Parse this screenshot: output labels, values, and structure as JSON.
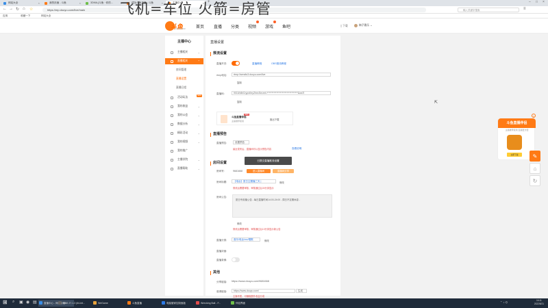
{
  "browser": {
    "tabs": [
      {
        "label": "网站大全",
        "color": "#3a8ee6"
      },
      {
        "label": "我的页面 - 斗鱼",
        "color": "#ff7a15"
      },
      {
        "label": "3DMA-[斗鱼 · 你的...",
        "color": "#6fbf4a"
      },
      {
        "label": "成功斗鱼主播 - 斗鱼",
        "color": "#ff7a15"
      },
      {
        "label": "主播中心",
        "color": "#ff7a15"
      }
    ],
    "url": "https://mp.douyu.com/live/main",
    "search_placeholder": "输入关键字搜索",
    "bookmarks": [
      "应用",
      "收藏一下",
      "网站大全"
    ]
  },
  "overlay_text": "飞机=车位 火箭=房管",
  "site": {
    "logo_text": "斗鱼",
    "logo_sub": "DOUYU.COM",
    "nav": [
      "首页",
      "直播",
      "分类",
      "视频",
      "游戏",
      "鱼吧"
    ],
    "phone_label": "下载",
    "user_label": "梅子雅乐"
  },
  "sidebar": {
    "title": "主播中心",
    "items": [
      {
        "label": "主播相关",
        "active": false
      },
      {
        "label": "直播相关",
        "active": true
      }
    ],
    "subitems": [
      {
        "label": "房间管理",
        "on": false
      },
      {
        "label": "直播设置",
        "on": true
      },
      {
        "label": "直播日程",
        "on": false
      }
    ],
    "items2": [
      {
        "label": "活动玩法",
        "new": true
      },
      {
        "label": "我的收益",
        "new": false
      },
      {
        "label": "我的公会",
        "new": false
      },
      {
        "label": "数据分析",
        "new": false
      },
      {
        "label": "精彩活动",
        "new": false
      },
      {
        "label": "我的视频",
        "new": false
      },
      {
        "label": "我的推广",
        "new": false
      },
      {
        "label": "主播学院",
        "new": false
      },
      {
        "label": "直播帮助",
        "new": false
      }
    ],
    "new_tag": "NEW"
  },
  "main": {
    "page_title": "直播设置",
    "sec_push": "推流设置",
    "push_label": "直播开关:",
    "push_link1": "直播教程",
    "push_link2": "OBS推流教程",
    "rtmp_label": "rtmp地址:",
    "rtmp_value": "rtmp://sendtc3.douyu.com/live",
    "copy": "复制",
    "key_label": "直播码:",
    "key_value": "9016/b8rCrypsKeyZhecSecret=*********************************&wsTi",
    "helper_title": "斗鱼直播伴侣",
    "helper_sub": "主播推荐使用",
    "helper_new": "NEW",
    "helper_download": "推出下载",
    "sec_preview": "直播预告",
    "preview_label": "直播预告:",
    "preview_btn": "设置预告",
    "preview_note": "最近发布后，直播间可以显示预告内容",
    "preview_link": "查看说明",
    "toast": "已提交直播推流设置",
    "sec_room": "房间设置",
    "room_num_label": "房间号:",
    "room_num": "9681668",
    "room_btn1": "进入直播间",
    "room_btn2": "直播间分享",
    "room_name_label": "房间标题:",
    "room_name": "【电台】夏日主题播三天 |",
    "room_name_btn": "修改",
    "room_name_note": "修改后需要审核，审核通过后30分钟显示",
    "announce_label": "房间公告:",
    "announce_text": "夏日专用播公告 - 每日直播时间14:00-24:00 - 周日不定期休息 -",
    "announce_btn": "修改",
    "announce_note": "修改后需要审核，审核通过后10分钟显示新公告",
    "category_label": "直播分类:",
    "category": "音乐/电台/mc/唱歌",
    "category_btn": "修改",
    "cover_label": "直播封面:",
    "record_label": "直播录像:",
    "sec_other": "其他",
    "share_label": "分享链接:",
    "share_url": "https://www.douyu.com/9681668",
    "invite_label": "邀请链接:",
    "invite_url": "https://www.douyu.com/",
    "invite_btn": "生成",
    "invite_note": "主播专属，可赚取额外收益分成"
  },
  "promo": {
    "title": "斗鱼直播伴侣",
    "sub": "主播推荐使用 直播更方便",
    "btn": "立即下载"
  },
  "taskbar": {
    "items": [
      {
        "label": "直播中心 - 网络传输...",
        "color": "#3a8ee6",
        "active": true
      },
      {
        "label": "OBS 27.1.3 (64-bit...",
        "color": "#444444",
        "active": false
      },
      {
        "label": "WeGame",
        "color": "#e8a33c",
        "active": false
      },
      {
        "label": "斗鱼直播",
        "color": "#ff7a15",
        "active": false
      },
      {
        "label": "电脑管家控制面板",
        "color": "#2d7ae5",
        "active": false
      },
      {
        "label": "Wrecking Ball - F...",
        "color": "#e34c4c",
        "active": false
      },
      {
        "label": "伴侣界面",
        "color": "#6fbf4a",
        "active": false
      }
    ],
    "time": "16:11",
    "date": "2022/8/21"
  }
}
